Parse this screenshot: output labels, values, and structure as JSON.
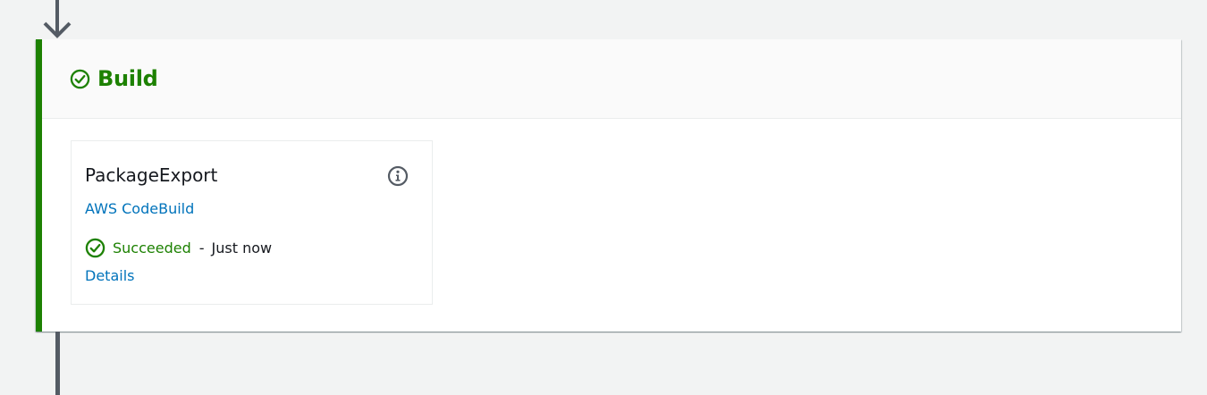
{
  "stage": {
    "name": "Build",
    "status_color": "#1d8102",
    "status_icon": "check-circle-icon"
  },
  "action": {
    "name": "PackageExport",
    "provider": "AWS CodeBuild",
    "status": "Succeeded",
    "separator": "-",
    "time": "Just now",
    "details_label": "Details",
    "info_icon": "info-icon",
    "status_icon": "check-circle-icon"
  },
  "colors": {
    "success": "#1d8102",
    "link": "#0073bb",
    "connector": "#545b64",
    "background": "#f2f3f3"
  }
}
